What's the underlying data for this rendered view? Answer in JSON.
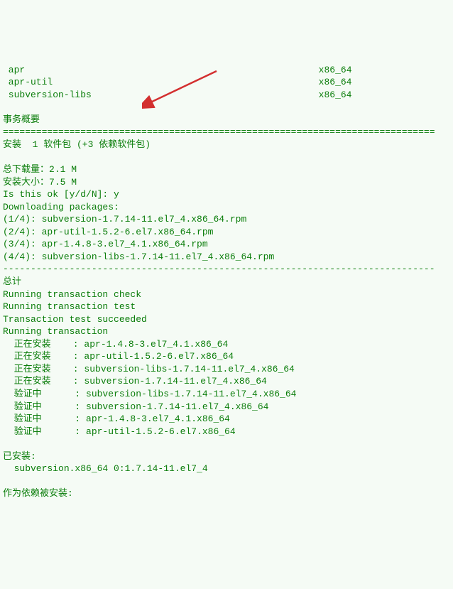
{
  "deps": {
    "row1_pkg": " apr",
    "row1_arch": "                                                     x86_64",
    "row2_pkg": " apr-util",
    "row2_arch": "                                                x86_64",
    "row3_pkg": " subversion-libs",
    "row3_arch": "                                         x86_64"
  },
  "section_summary_title": "事务概要",
  "divider": "==============================================================================",
  "install_line": "安装  1 软件包 (+3 依赖软件包)",
  "dl_size_label": "总下载量：",
  "dl_size_value": "2.1 M",
  "install_size_label": "安装大小：",
  "install_size_value": "7.5 M",
  "prompt": "Is this ok [y/d/N]: ",
  "prompt_answer": "y",
  "downloading_label": "Downloading packages:",
  "pkg_lines": {
    "l1": "(1/4): subversion-1.7.14-11.el7_4.x86_64.rpm",
    "l2": "(2/4): apr-util-1.5.2-6.el7.x86_64.rpm",
    "l3": "(3/4): apr-1.4.8-3.el7_4.1.x86_64.rpm",
    "l4": "(4/4): subversion-libs-1.7.14-11.el7_4.x86_64.rpm"
  },
  "dash_divider": "------------------------------------------------------------------------------",
  "total_label": "总计",
  "tx_check": "Running transaction check",
  "tx_test": "Running transaction test",
  "tx_test_ok": "Transaction test succeeded",
  "tx_run": "Running transaction",
  "installing": {
    "l1": "  正在安装    : apr-1.4.8-3.el7_4.1.x86_64",
    "l2": "  正在安装    : apr-util-1.5.2-6.el7.x86_64",
    "l3": "  正在安装    : subversion-libs-1.7.14-11.el7_4.x86_64",
    "l4": "  正在安装    : subversion-1.7.14-11.el7_4.x86_64",
    "l5": "  验证中      : subversion-libs-1.7.14-11.el7_4.x86_64",
    "l6": "  验证中      : subversion-1.7.14-11.el7_4.x86_64",
    "l7": "  验证中      : apr-1.4.8-3.el7_4.1.x86_64",
    "l8": "  验证中      : apr-util-1.5.2-6.el7.x86_64"
  },
  "installed_label": "已安装:",
  "installed_pkg": "  subversion.x86_64 0:1.7.14-11.el7_4",
  "dep_installed_label": "作为依赖被安装:"
}
